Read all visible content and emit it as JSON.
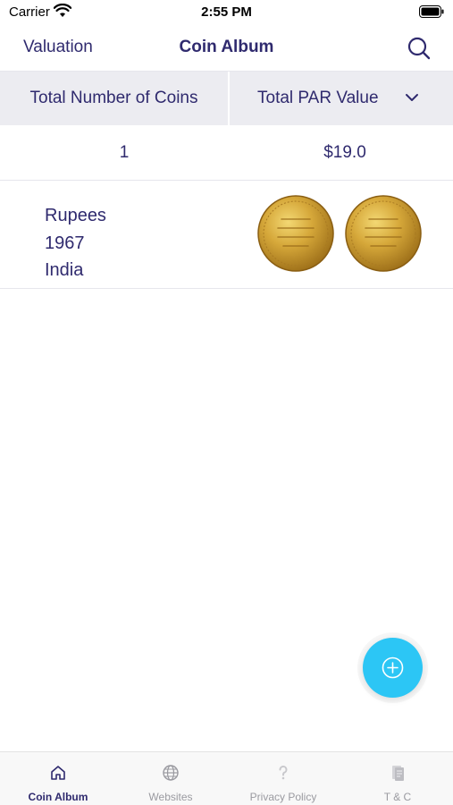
{
  "status_bar": {
    "carrier": "Carrier",
    "time": "2:55 PM"
  },
  "nav": {
    "left_label": "Valuation",
    "title": "Coin Album",
    "search_icon": "search-icon"
  },
  "table_header": {
    "count_label": "Total Number of Coins",
    "value_label": "Total PAR Value"
  },
  "totals": {
    "count": "1",
    "value": "$19.0"
  },
  "coins": [
    {
      "name": "Rupees",
      "year": "1967",
      "country": "India"
    }
  ],
  "fab": {
    "icon": "add-circle-icon",
    "color": "#2cc6f5"
  },
  "tabs": [
    {
      "label": "Coin Album",
      "icon": "home-icon",
      "active": true
    },
    {
      "label": "Websites",
      "icon": "globe-icon",
      "active": false
    },
    {
      "label": "Privacy Policy",
      "icon": "question-icon",
      "active": false
    },
    {
      "label": "T & C",
      "icon": "document-icon",
      "active": false
    }
  ],
  "colors": {
    "primary_text": "#2f2a6e",
    "header_bg": "#ececf1",
    "accent": "#2cc6f5",
    "coin_gold": "#c9962a"
  }
}
